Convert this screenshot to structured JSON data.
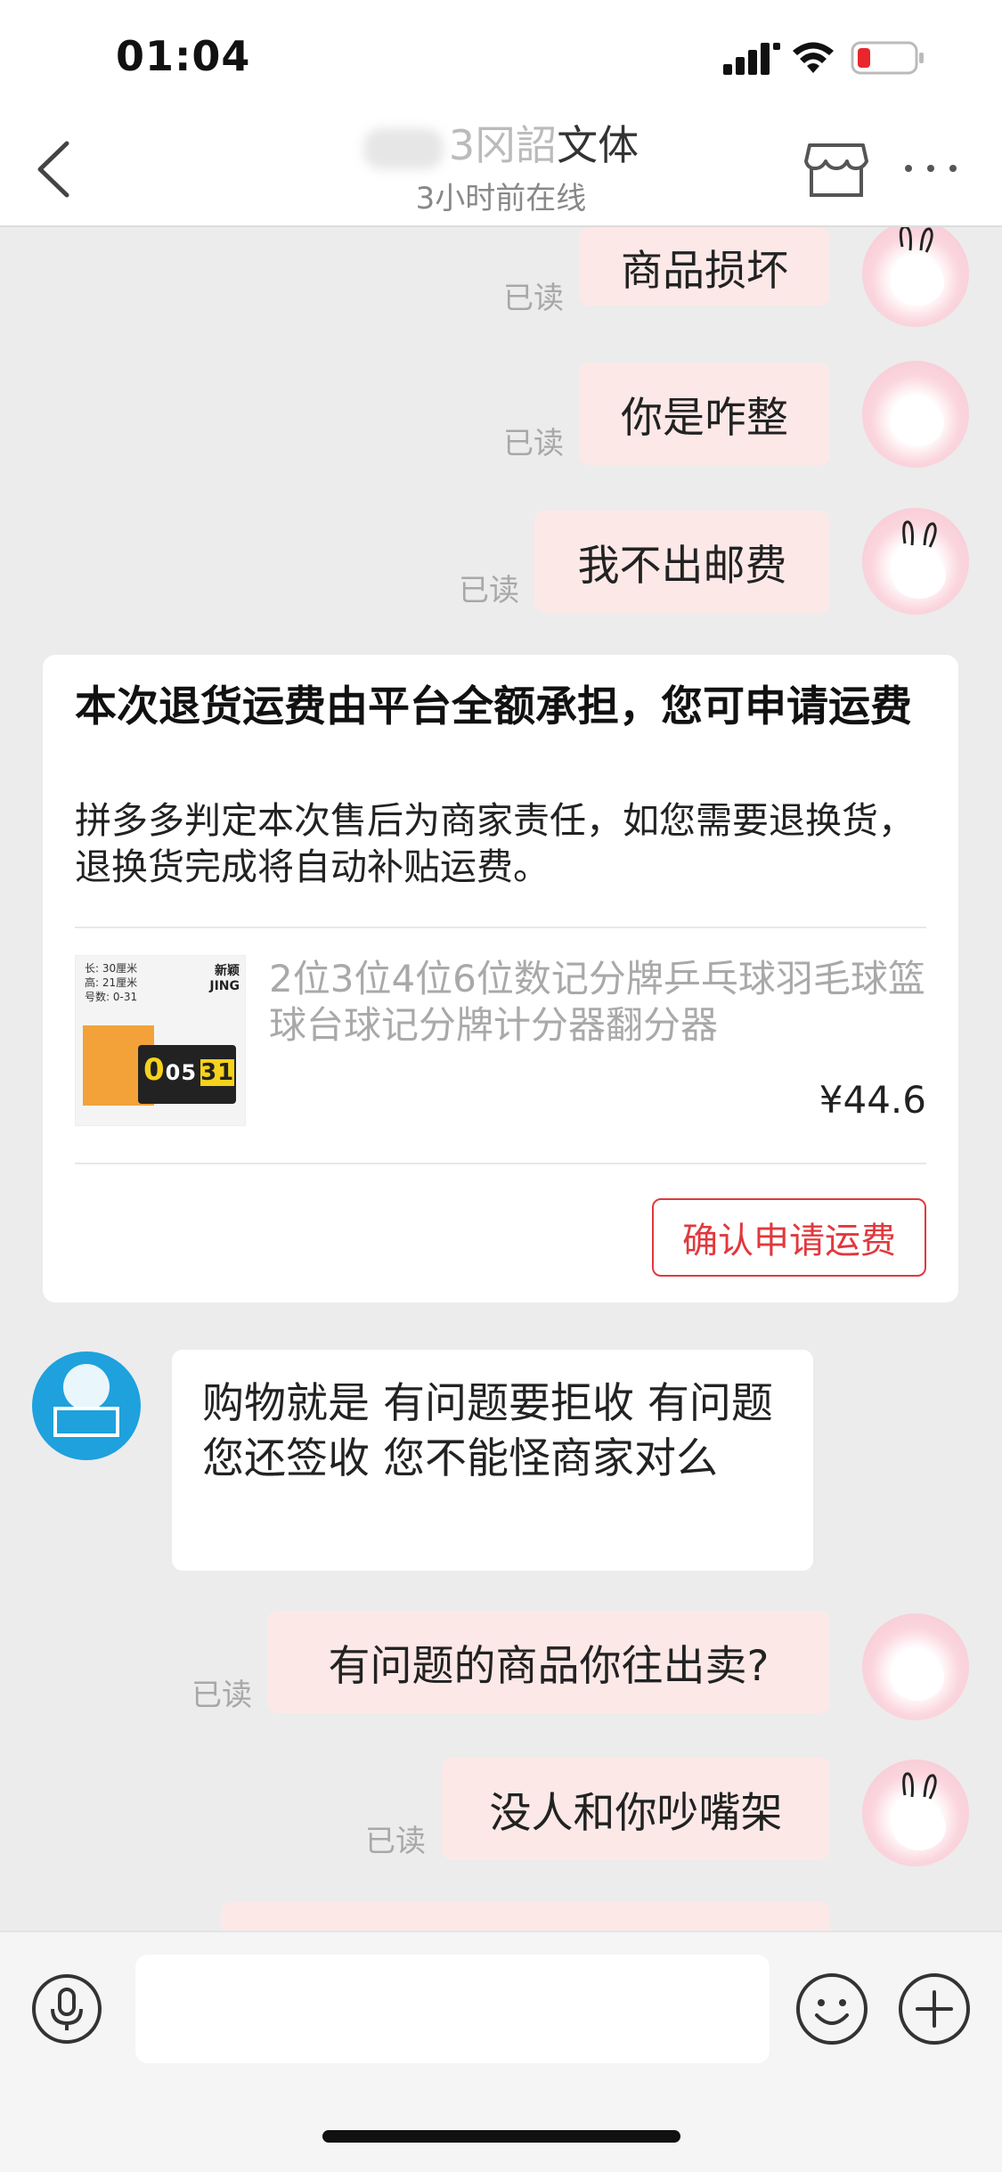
{
  "status_bar": {
    "time": "01:04"
  },
  "header": {
    "shop_name": "文体",
    "shop_name_partial": "3冈詔",
    "status": "3小时前在线"
  },
  "messages": [
    {
      "from": "me",
      "text": "商品损坏",
      "read": "已读"
    },
    {
      "from": "me",
      "text": "你是咋整",
      "read": "已读"
    },
    {
      "from": "me",
      "text": "我不出邮费",
      "read": "已读"
    },
    {
      "from": "shop",
      "text": "购物就是  有问题要拒收  有问题您还签收  您不能怪商家对么"
    },
    {
      "from": "me",
      "text": "有问题的商品你往出卖?",
      "read": "已读"
    },
    {
      "from": "me",
      "text": "没人和你吵嘴架",
      "read": "已读"
    }
  ],
  "refund_card": {
    "title": "本次退货运费由平台全额承担，您可申请运费",
    "description": "拼多多判定本次售后为商家责任，如您需要退换货，退换货完成将自动补贴运费。",
    "product": {
      "title": "2位3位4位6位数记分牌乒乓球羽毛球篮球台球记分牌计分器翻分器",
      "price": "¥44.6",
      "image_brand": "新颖 JING",
      "image_spec": [
        "长: 30厘米",
        "高: 21厘米",
        "号数: 0-31"
      ],
      "image_digits": [
        "0",
        "0",
        "5",
        "31"
      ]
    },
    "confirm_button": "确认申请运费"
  },
  "colors": {
    "bubble_me": "#fde8e8",
    "accent_red": "#e0393e",
    "shop_avatar": "#1ea1dd"
  },
  "icons": [
    "back-icon",
    "store-icon",
    "more-icon",
    "mic-icon",
    "emoji-icon",
    "plus-icon"
  ]
}
